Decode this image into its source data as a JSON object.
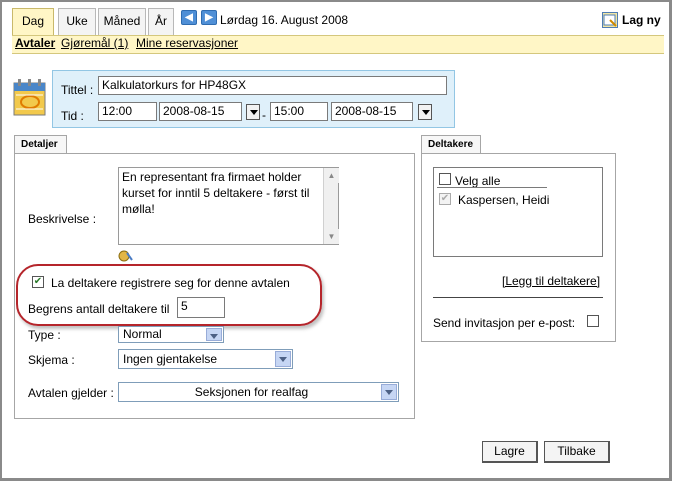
{
  "tabs": [
    {
      "label": "Dag",
      "active": true
    },
    {
      "label": "Uke",
      "active": false
    },
    {
      "label": "Måned",
      "active": false
    },
    {
      "label": "År",
      "active": false
    }
  ],
  "nav": {
    "prev_icon": "arrow-left-icon",
    "next_icon": "arrow-right-icon",
    "date": "Lørdag 16. August 2008"
  },
  "new_button": {
    "label": "Lag ny",
    "icon": "new-appointment-icon"
  },
  "sublinks": {
    "avtaler": "Avtaler",
    "gjoremal": "Gjøremål (1)",
    "reservasjoner": "Mine reservasjoner"
  },
  "form": {
    "title_label": "Tittel :",
    "title_value": "Kalkulatorkurs for HP48GX",
    "time_label": "Tid :",
    "start_time": "12:00",
    "start_date": "2008-08-15",
    "dash": "-",
    "end_time": "15:00",
    "end_date": "2008-08-15"
  },
  "details": {
    "tab_label": "Detaljer",
    "description_label": "Beskrivelse :",
    "description_value": "En representant fra firmaet holder kurset for inntil 5 deltakere - først til mølla!",
    "self_register_label": "La deltakere registrere seg for denne avtalen",
    "self_register_checked": true,
    "limit_label": "Begrens antall deltakere til",
    "limit_value": "5",
    "type_label": "Type :",
    "type_value": "Normal",
    "schema_label": "Skjema :",
    "schema_value": "Ingen gjentakelse",
    "applies_label": "Avtalen gjelder :",
    "applies_value": "Seksjonen for realfag"
  },
  "participants": {
    "tab_label": "Deltakere",
    "select_all_label": "Velg alle",
    "list": [
      {
        "name": "Kaspersen, Heidi",
        "checked": true
      }
    ],
    "add_link": "[Legg til deltakere]",
    "send_invite_label": "Send invitasjon per e-post:"
  },
  "buttons": {
    "save": "Lagre",
    "back": "Tilbake"
  },
  "colors": {
    "tab_active": "#fff6c6",
    "title_box": "#dff0fa",
    "highlight_oval": "#b5252b",
    "nav_arrow": "#4f8fd6"
  }
}
